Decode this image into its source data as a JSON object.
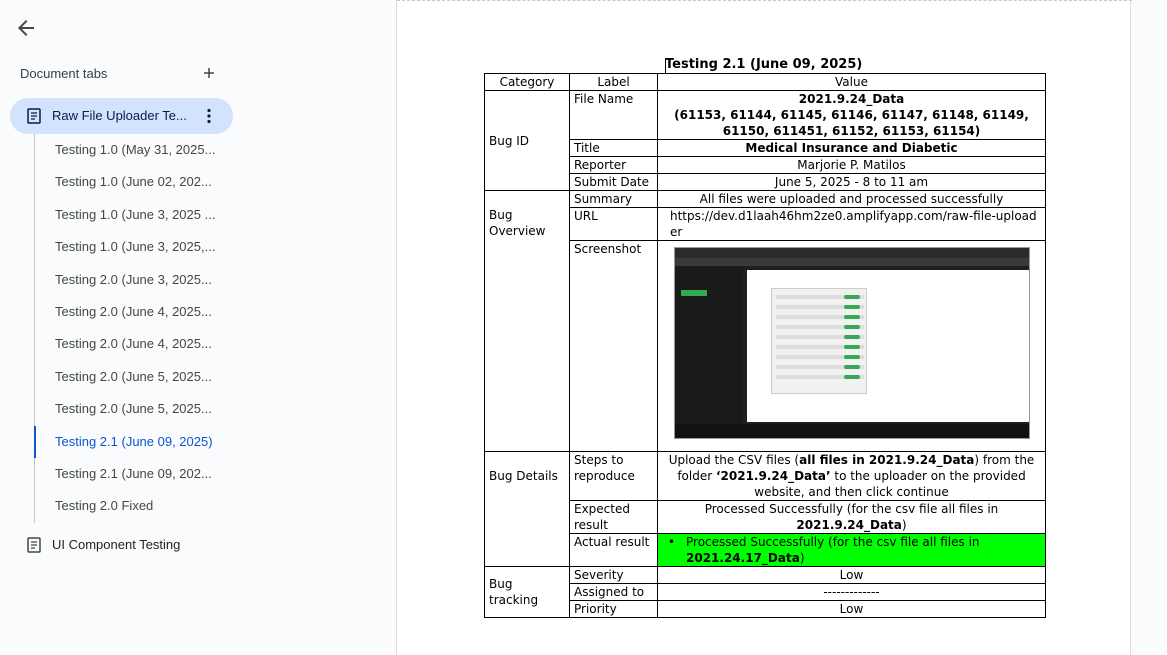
{
  "sidebar": {
    "header": "Document tabs",
    "main_tab": "Raw File Uploader Te...",
    "subtabs": [
      "Testing 1.0 (May 31, 2025...",
      "Testing 1.0 (June 02, 202...",
      "Testing 1.0 (June 3, 2025 ...",
      "Testing 1.0 (June 3, 2025,...",
      "Testing 2.0 (June 3, 2025...",
      "Testing 2.0 (June 4, 2025...",
      "Testing 2.0 (June 4, 2025...",
      "Testing 2.0 (June 5, 2025...",
      "Testing 2.0 (June 5, 2025...",
      "Testing 2.1 (June 09, 2025)",
      "Testing 2.1 (June 09, 202...",
      "Testing 2.0 Fixed"
    ],
    "active_subtab_index": 9,
    "other_tab": "UI Component Testing"
  },
  "document": {
    "title": "Testing 2.1 (June 09, 2025)",
    "headers": {
      "category": "Category",
      "label": "Label",
      "value": "Value"
    },
    "bug_id": {
      "category": "Bug ID",
      "file_name_label": "File Name",
      "file_name_value": "2021.9.24_Data",
      "file_name_list": "(61153, 61144, 61145, 61146, 61147, 61148, 61149, 61150, 611451, 61152, 61153, 61154)",
      "title_label": "Title",
      "title_value": "Medical Insurance and Diabetic",
      "reporter_label": "Reporter",
      "reporter_value": "Marjorie P. Matilos",
      "submit_label": "Submit Date",
      "submit_value": "June 5, 2025 - 8 to 11 am"
    },
    "overview": {
      "category": "Bug Overview",
      "summary_label": "Summary",
      "summary_value": "All files were uploaded and processed successfully",
      "url_label": "URL",
      "url_value": "https://dev.d1laah46hm2ze0.amplifyapp.com/raw-file-uploader",
      "screenshot_label": "Screenshot"
    },
    "details": {
      "category": "Bug Details",
      "steps_label": "Steps to reproduce",
      "steps_prefix": "Upload the CSV files (",
      "steps_bold1": "all files in 2021.9.24_Data",
      "steps_mid": ") from the folder ",
      "steps_bold2": "‘2021.9.24_Data’",
      "steps_suffix": " to the uploader on the provided website, and then click continue",
      "expected_label": "Expected result",
      "expected_value": "Processed Successfully (for the csv file all files in",
      "expected_bold": "2021.9.24_Data",
      "expected_tail": ")",
      "actual_label": "Actual result",
      "actual_value": "Processed Successfully (for the csv file all files in",
      "actual_bold": "2021.24.17_Data",
      "actual_tail": ")"
    },
    "tracking": {
      "category": "Bug tracking",
      "severity_label": "Severity",
      "severity_value": "Low",
      "assigned_label": "Assigned to",
      "assigned_value": "-------------",
      "priority_label": "Priority",
      "priority_value": "Low"
    }
  },
  "colors": {
    "active_tab_bg": "#d3e3fd",
    "active_subtab": "#0b57d0",
    "highlight_green": "#00ff00"
  },
  "icons": [
    "back-arrow-icon",
    "add-icon",
    "document-icon",
    "more-vert-icon"
  ]
}
